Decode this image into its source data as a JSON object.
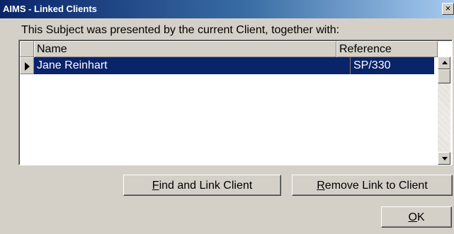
{
  "window": {
    "title": "AIMS - Linked Clients",
    "close_glyph": "×"
  },
  "message": "This Subject was presented by the current Client, together with:",
  "grid": {
    "columns": [
      "Name",
      "Reference"
    ],
    "rows": [
      {
        "name": "Jane Reinhart",
        "reference": "SP/330",
        "selected": true
      }
    ]
  },
  "buttons": {
    "find_link": {
      "accel": "F",
      "rest": "ind and Link Client"
    },
    "remove_link": {
      "accel": "R",
      "rest": "emove Link to Client"
    },
    "ok": {
      "accel": "O",
      "rest": "K"
    }
  },
  "colors": {
    "selection": "#0a246a",
    "dialog_bg": "#d4d0c8"
  }
}
